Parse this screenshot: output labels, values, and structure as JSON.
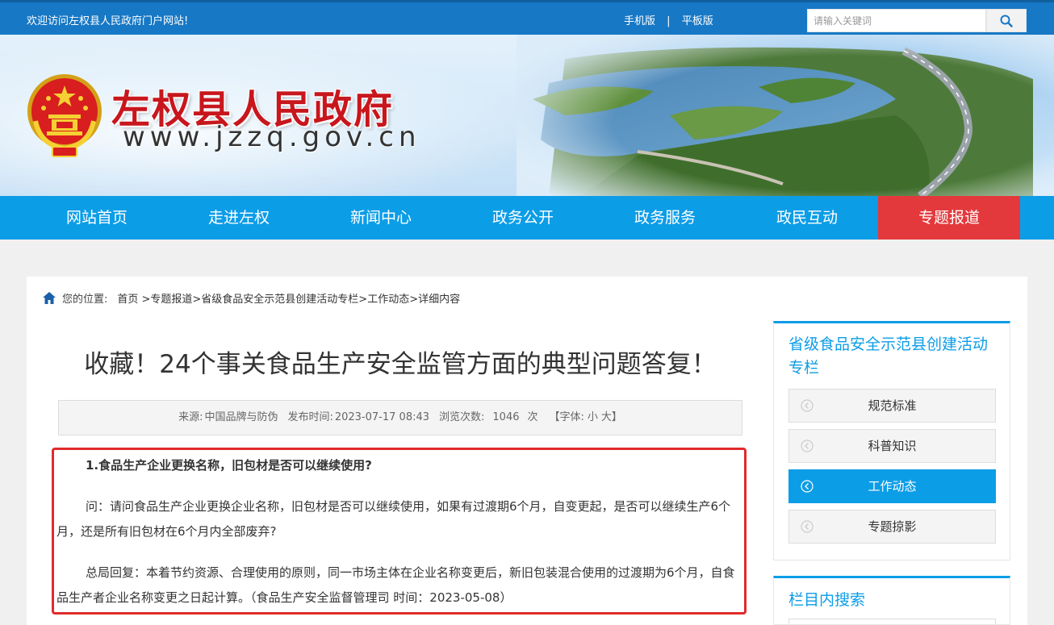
{
  "topbar": {
    "welcome": "欢迎访问左权县人民政府门户网站!",
    "mobile": "手机版",
    "separator": "|",
    "tablet": "平板版",
    "search_placeholder": "请输入关键词"
  },
  "banner": {
    "site_name": "左权县人民政府",
    "site_url": "www.jzzq.gov.cn"
  },
  "nav": {
    "items": [
      "网站首页",
      "走进左权",
      "新闻中心",
      "政务公开",
      "政务服务",
      "政民互动",
      "专题报道"
    ],
    "active_index": 6
  },
  "breadcrumb": {
    "label": "您的位置:",
    "path": "首页 >专题报道>省级食品安全示范县创建活动专栏>工作动态>详细内容"
  },
  "article": {
    "title": "收藏！24个事关食品生产安全监管方面的典型问题答复！",
    "meta": {
      "source_label": "来源:",
      "source": "中国品牌与防伪",
      "date_label": "发布时间:",
      "date": "2023-07-17 08:43",
      "views_label": "浏览次数:",
      "views": "1046",
      "views_unit": "次",
      "font_label": "【字体:",
      "font_small": "小",
      "font_large": "大】"
    },
    "q_title": "1.食品生产企业更换名称，旧包材是否可以继续使用?",
    "question": "问：请问食品生产企业更换企业名称，旧包材是否可以继续使用，如果有过渡期6个月，自变更起，是否可以继续生产6个月，还是所有旧包材在6个月内全部废弃?",
    "answer": "总局回复：本着节约资源、合理使用的原则，同一市场主体在企业名称变更后，新旧包装混合使用的过渡期为6个月，自食品生产者企业名称变更之日起计算。（食品生产安全监督管理司  时间：2023-05-08）"
  },
  "sidebar": {
    "heading": "省级食品安全示范县创建活动专栏",
    "items": [
      "规范标准",
      "科普知识",
      "工作动态",
      "专题掠影"
    ],
    "active_index": 2,
    "search_heading": "栏目内搜索"
  },
  "colors": {
    "topbar": "#1778c5",
    "nav": "#0c9de7",
    "nav_active": "#e4393c",
    "site_name": "#c8161d",
    "highlight_border": "#e02b2b"
  }
}
